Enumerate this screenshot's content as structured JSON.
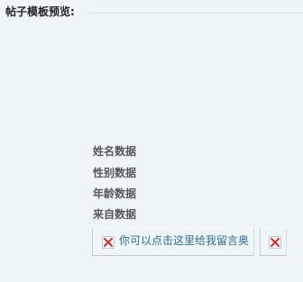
{
  "section": {
    "title": "帖子模板预览:"
  },
  "preview": {
    "name_label": "姓名数据",
    "gender_label": "性别数据",
    "age_label": "年龄数据",
    "origin_label": "来自数据"
  },
  "actions": {
    "leave_message_label": "你可以点击这里给我留言奥"
  },
  "icons": {
    "broken_image_icon": "broken-image-icon"
  },
  "colors": {
    "background": "#eef5f9",
    "link_text": "#2e6e8a",
    "icon_x": "#d9252d"
  }
}
